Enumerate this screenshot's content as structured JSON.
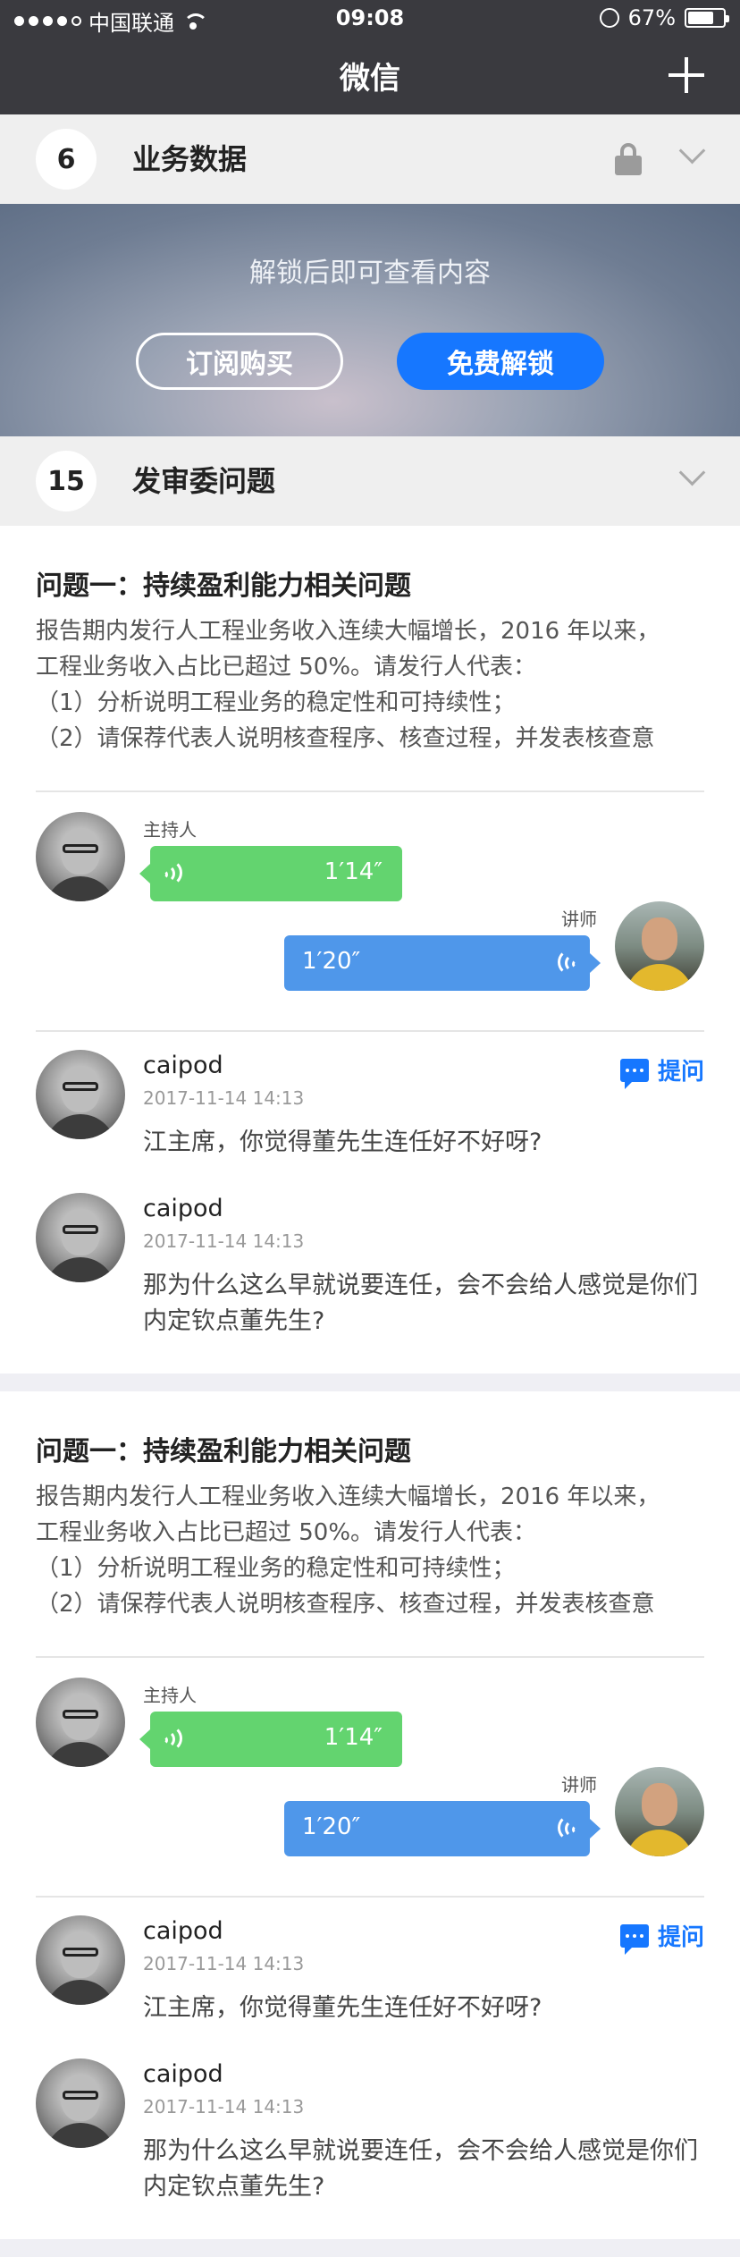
{
  "status_bar": {
    "carrier": "中国联通",
    "time": "09:08",
    "battery": "67%"
  },
  "nav": {
    "title": "微信"
  },
  "sections": {
    "business": {
      "number": "6",
      "title": "业务数据"
    },
    "committee": {
      "number": "15",
      "title": "发审委问题"
    }
  },
  "locked": {
    "message": "解锁后即可查看内容",
    "subscribe_label": "订阅购买",
    "unlock_label": "免费解锁"
  },
  "question": {
    "title": "问题一：持续盈利能力相关问题",
    "lines": [
      "报告期内发行人工程业务收入连续大幅增长，2016 年以来，",
      "工程业务收入占比已超过 50%。请发行人代表：",
      "（1）分析说明工程业务的稳定性和可持续性；",
      "（2）请保荐代表人说明核查程序、核查过程，并发表核查意"
    ]
  },
  "audio": {
    "host_role": "主持人",
    "host_duration": "1′14″",
    "speaker_role": "讲师",
    "speaker_duration": "1′20″"
  },
  "ask_label": "提问",
  "comments": [
    {
      "name": "caipod",
      "time": "2017-11-14 14:13",
      "text": "江主席，你觉得董先生连任好不好呀?"
    },
    {
      "name": "caipod",
      "time": "2017-11-14 14:13",
      "text": "那为什么这么早就说要连任，会不会给人感觉是你们内定钦点董先生?"
    }
  ]
}
